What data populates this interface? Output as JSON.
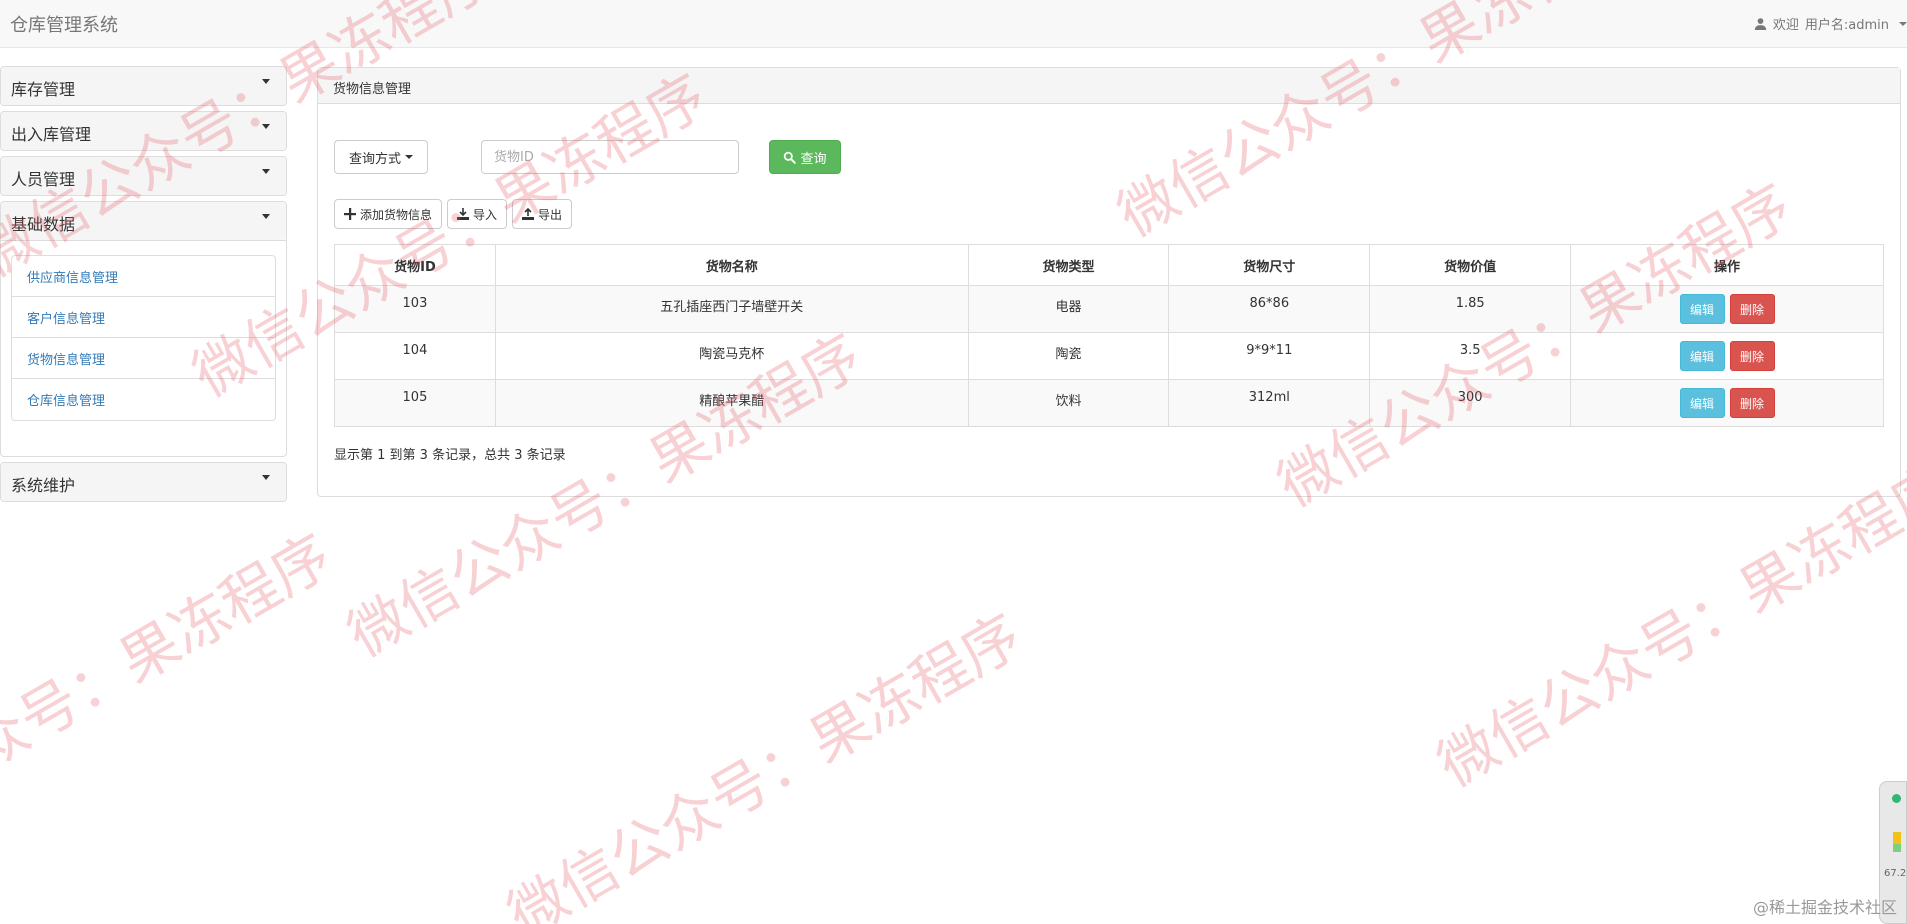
{
  "app": {
    "title": "仓库管理系统",
    "welcome": "欢迎",
    "username_label": "用户名:admin"
  },
  "sidebar": {
    "menus": [
      {
        "label": "库存管理"
      },
      {
        "label": "出入库管理"
      },
      {
        "label": "人员管理"
      },
      {
        "label": "基础数据"
      },
      {
        "label": "系统维护"
      }
    ],
    "sub_items": [
      {
        "label": "供应商信息管理"
      },
      {
        "label": "客户信息管理"
      },
      {
        "label": "货物信息管理"
      },
      {
        "label": "仓库信息管理"
      }
    ]
  },
  "main": {
    "panel_title": "货物信息管理",
    "query_mode_label": "查询方式",
    "search_placeholder": "货物ID",
    "search_value": "",
    "search_button": "查询",
    "toolbar": {
      "add_label": "添加货物信息",
      "import_label": "导入",
      "export_label": "导出"
    },
    "table": {
      "headers": [
        "货物ID",
        "货物名称",
        "货物类型",
        "货物尺寸",
        "货物价值",
        "操作"
      ],
      "rows": [
        {
          "id": "103",
          "name": "五孔插座西门子墙壁开关",
          "type": "电器",
          "size": "86*86",
          "value": "1.85",
          "edit": "编辑",
          "delete": "删除"
        },
        {
          "id": "104",
          "name": "陶瓷马克杯",
          "type": "陶瓷",
          "size": "9*9*11",
          "value": "3.5",
          "edit": "编辑",
          "delete": "删除"
        },
        {
          "id": "105",
          "name": "精酿苹果醋",
          "type": "饮料",
          "size": "312ml",
          "value": "300",
          "edit": "编辑",
          "delete": "删除"
        }
      ]
    },
    "pagination_info": "显示第 1 到第 3 条记录，总共 3 条记录"
  },
  "watermark": {
    "text": "微信公众号：果冻程序"
  },
  "footer": {
    "credit": "@稀土掘金技术社区"
  },
  "side_widget": {
    "value": "67.2"
  }
}
